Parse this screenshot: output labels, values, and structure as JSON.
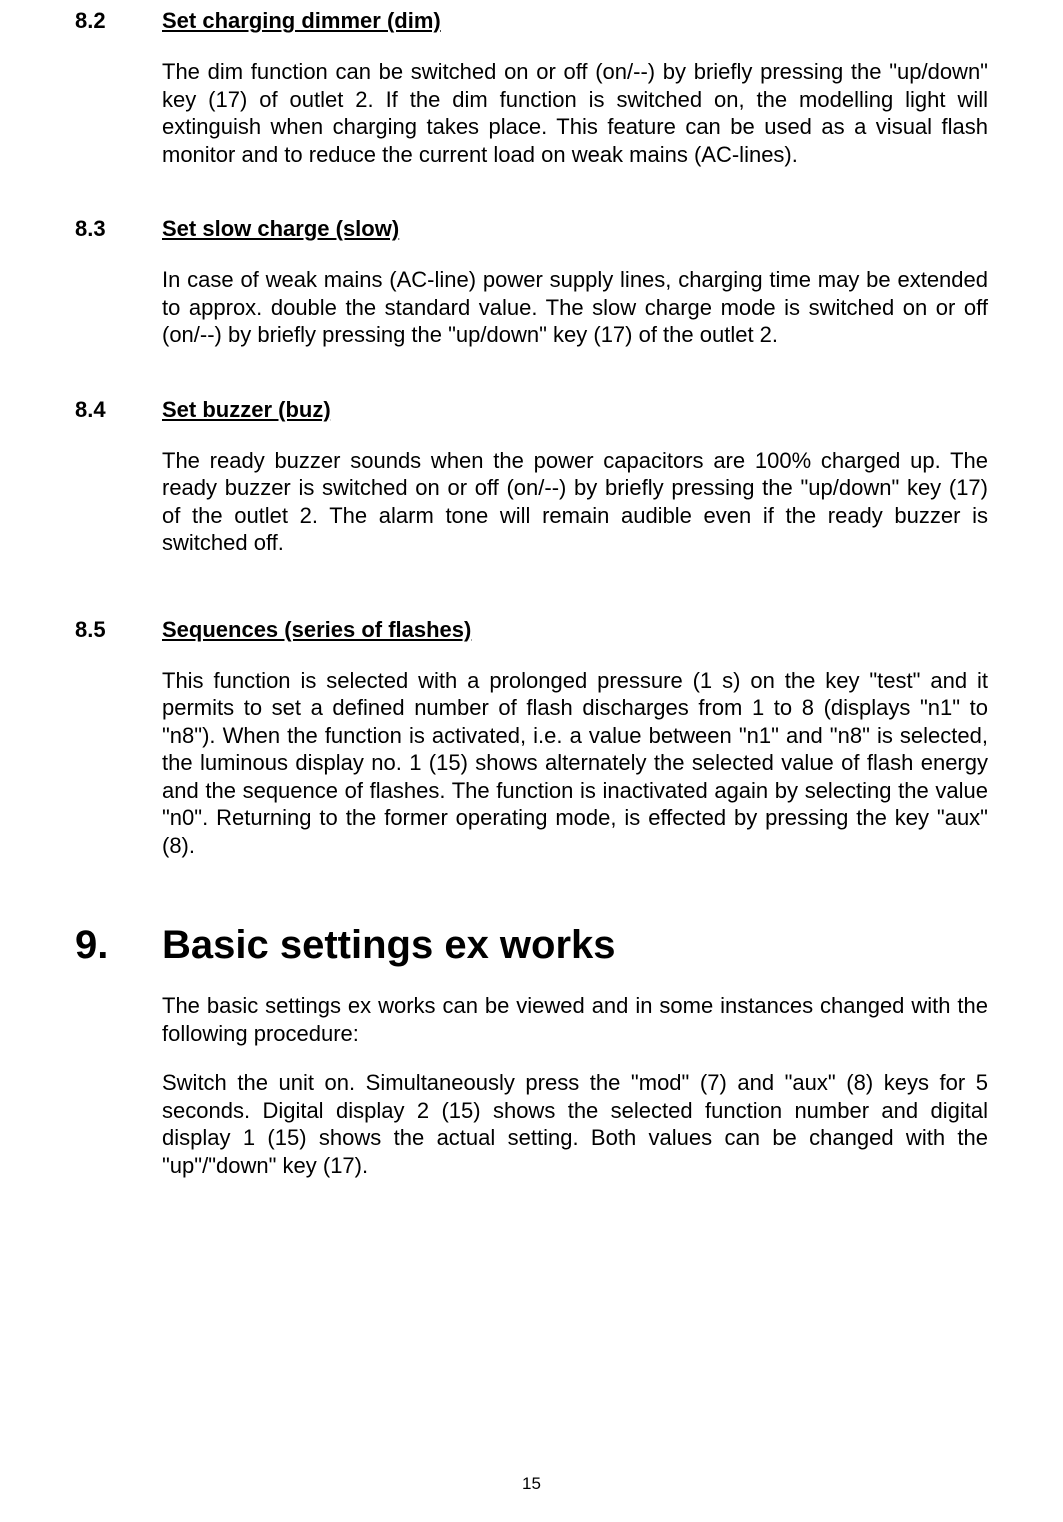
{
  "sections": {
    "s82": {
      "number": "8.2",
      "title": "Set charging dimmer (dim)",
      "body": "The dim function can be switched on or off (on/--) by briefly pressing the \"up/down\" key (17) of outlet 2. If the dim function is switched on, the modelling light will extinguish when charging takes place. This feature can be used as a visual flash monitor and to reduce the current load on weak mains (AC-lines)."
    },
    "s83": {
      "number": "8.3",
      "title": "Set slow charge (slow)",
      "body": "In case of weak mains (AC-line) power supply lines, charging time may be extended to approx. double the standard value. The slow charge mode is switched on or off (on/--) by briefly pressing the \"up/down\" key (17) of the outlet 2."
    },
    "s84": {
      "number": "8.4",
      "title": "Set buzzer (buz)",
      "body": "The ready buzzer sounds when the power capacitors are 100% charged up. The ready buzzer is switched on or off (on/--) by briefly pressing the \"up/down\" key (17) of the outlet 2. The alarm tone will remain audible even if the ready buzzer is switched off."
    },
    "s85": {
      "number": "8.5",
      "title": "Sequences (series of flashes)",
      "body": "This function is selected with a prolonged pressure (1 s) on the key \"test\" and it permits to set a defined number of flash discharges from 1 to 8 (displays \"n1\" to \"n8\"). When the function is activated, i.e. a value between \"n1\" and \"n8\" is selected, the luminous display no. 1 (15) shows alternately the selected value of flash energy and the sequence of flashes. The function is inactivated again by selecting the value \"n0\". Returning to the former operating mode, is effected by pressing the key \"aux\" (8)."
    }
  },
  "chapter": {
    "number": "9.",
    "title": "Basic settings ex works",
    "para1": "The basic settings ex works can be viewed and in some instances changed with the following procedure:",
    "para2": "Switch the unit on. Simultaneously press the \"mod\" (7) and \"aux\" (8) keys for 5 seconds. Digital display 2 (15) shows the selected function number and digital display 1 (15) shows the actual setting. Both values can be changed with the \"up\"/\"down\" key (17)."
  },
  "page_number": "15"
}
